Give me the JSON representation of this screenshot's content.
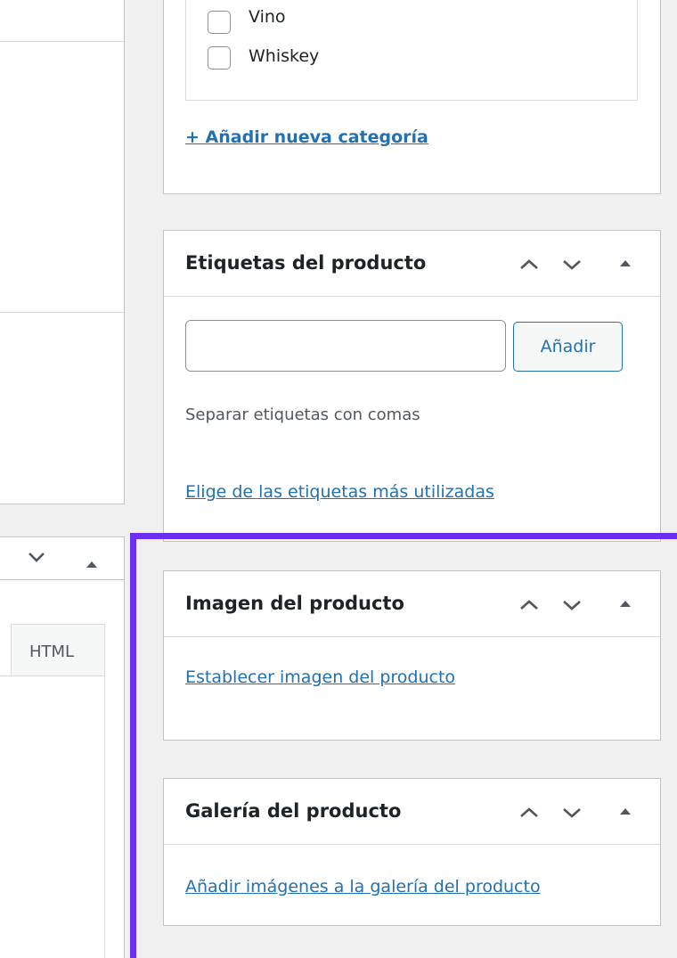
{
  "categories": {
    "items": [
      "Vino",
      "Whiskey"
    ],
    "add_new_link": "+ Añadir nueva categoría"
  },
  "tags_box": {
    "title": "Etiquetas del producto",
    "input_value": "",
    "add_button": "Añadir",
    "help_text": "Separar etiquetas con comas",
    "most_used_link": "Elige de las etiquetas más utilizadas"
  },
  "image_box": {
    "title": "Imagen del producto",
    "set_image_link": "Establecer imagen del producto"
  },
  "gallery_box": {
    "title": "Galería del producto",
    "add_images_link": "Añadir imágenes a la galería del producto"
  },
  "editor": {
    "html_tab": "HTML"
  },
  "colors": {
    "highlight": "#6b2ff2",
    "link": "#2271b1"
  }
}
